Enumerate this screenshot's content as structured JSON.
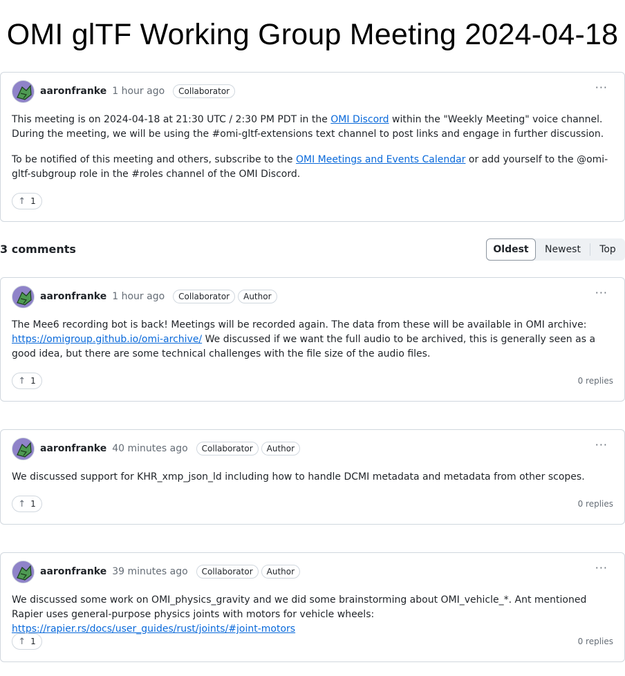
{
  "page": {
    "title": "OMI glTF Working Group Meeting 2024-04-18"
  },
  "post": {
    "author": "aaronfranke",
    "time": "1 hour ago",
    "badges": [
      "Collaborator"
    ],
    "p1": {
      "before": "This meeting is on 2024-04-18 at 21:30 UTC / 2:30 PM PDT in the ",
      "link": "OMI Discord",
      "after": " within the \"Weekly Meeting\" voice channel. During the meeting, we will be using the #omi-gltf-extensions text channel to post links and engage in further discussion."
    },
    "p2": {
      "before": "To be notified of this meeting and others, subscribe to the ",
      "link": "OMI Meetings and Events Calendar",
      "after": " or add yourself to the @omi-gltf-subgroup role in the #roles channel of the OMI Discord."
    },
    "reaction": {
      "icon": "arrow-up-icon",
      "count": "1"
    }
  },
  "comments_header": {
    "count_label": "3 comments",
    "sort": [
      "Oldest",
      "Newest",
      "Top"
    ],
    "active_sort": "Oldest"
  },
  "comments": [
    {
      "author": "aaronfranke",
      "time": "1 hour ago",
      "badges": [
        "Collaborator",
        "Author"
      ],
      "before": "The Mee6 recording bot is back! Meetings will be recorded again. The data from these will be available in OMI archive: ",
      "link": "https://omigroup.github.io/omi-archive/",
      "after": " We discussed if we want the full audio to be archived, this is generally seen as a good idea, but there are some technical challenges with the file size of the audio files.",
      "reaction_count": "1",
      "replies": "0 replies"
    },
    {
      "author": "aaronfranke",
      "time": "40 minutes ago",
      "badges": [
        "Collaborator",
        "Author"
      ],
      "before": "We discussed support for KHR_xmp_json_ld including how to handle DCMI metadata and metadata from other scopes.",
      "link": "",
      "after": "",
      "reaction_count": "1",
      "replies": "0 replies"
    },
    {
      "author": "aaronfranke",
      "time": "39 minutes ago",
      "badges": [
        "Collaborator",
        "Author"
      ],
      "before": "We discussed some work on OMI_physics_gravity and we did some brainstorming about OMI_vehicle_*. Ant mentioned Rapier uses general-purpose physics joints with motors for vehicle wheels: ",
      "link": "https://rapier.rs/docs/user_guides/rust/joints/#joint-motors",
      "after": "",
      "reaction_count": "1",
      "replies": "0 replies"
    }
  ],
  "icons": {
    "kebab": "kebab-horizontal-icon",
    "upvote": "arrow-up-icon",
    "avatar": "identicon-avatar"
  },
  "colors": {
    "link": "#0969da",
    "border": "#d0d7de",
    "muted": "#656d76",
    "avatar_bg": "#8f83c9"
  }
}
